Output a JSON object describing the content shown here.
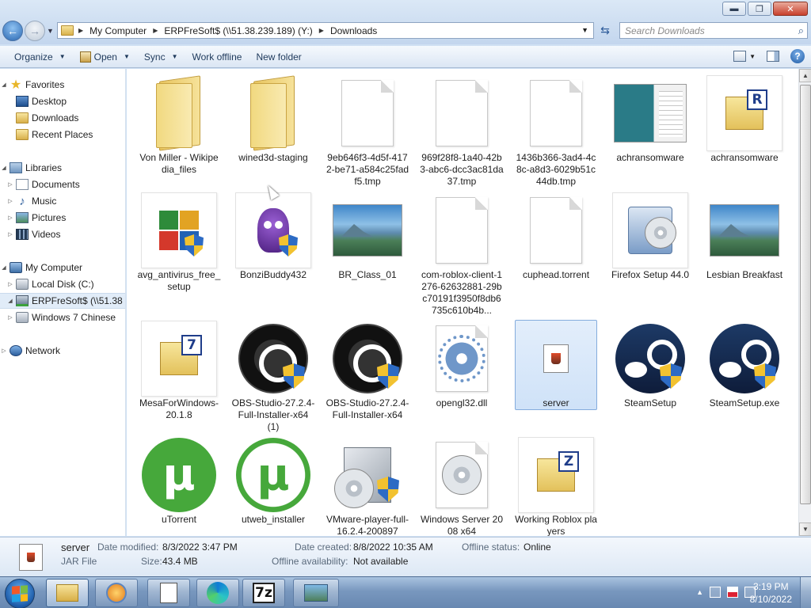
{
  "window": {
    "minimize": "▬",
    "maximize": "❐",
    "close": "✕"
  },
  "address": {
    "crumbs": [
      "My Computer",
      "ERPFreSoft$ (\\\\51.38.239.189) (Y:)",
      "Downloads"
    ],
    "search_placeholder": "Search Downloads"
  },
  "toolbar": {
    "organize": "Organize",
    "open": "Open",
    "sync": "Sync",
    "work_offline": "Work offline",
    "new_folder": "New folder"
  },
  "nav": {
    "favorites": "Favorites",
    "desktop": "Desktop",
    "downloads": "Downloads",
    "recent_places": "Recent Places",
    "libraries": "Libraries",
    "documents": "Documents",
    "music": "Music",
    "pictures": "Pictures",
    "videos": "Videos",
    "my_computer": "My Computer",
    "local_disk": "Local Disk (C:)",
    "erp_drive": "ERPFreSoft$ (\\\\51.38",
    "win7_chinese": "Windows 7 Chinese",
    "network": "Network"
  },
  "files": [
    {
      "name": "Von Miller - Wikipedia_files",
      "icon": "folder-icon"
    },
    {
      "name": "wined3d-staging",
      "icon": "folder-icon"
    },
    {
      "name": "9eb646f3-4d5f-4172-be71-a584c25fadf5.tmp",
      "icon": "blank-file-icon"
    },
    {
      "name": "969f28f8-1a40-42b3-abc6-dcc3ac81da37.tmp",
      "icon": "blank-file-icon"
    },
    {
      "name": "1436b366-3ad4-4c8c-a8d3-6029b51c44db.tmp",
      "icon": "blank-file-icon"
    },
    {
      "name": "achransomware",
      "icon": "screenshot-thumbnail"
    },
    {
      "name": "achransomware",
      "icon": "winrar-archive-icon"
    },
    {
      "name": "avg_antivirus_free_setup",
      "icon": "avg-installer-icon"
    },
    {
      "name": "BonziBuddy432",
      "icon": "bonzibuddy-icon"
    },
    {
      "name": "BR_Class_01",
      "icon": "landscape-image-thumbnail"
    },
    {
      "name": "com-roblox-client-1276-62632881-29bc70191f3950f8db6735c610b4b...",
      "icon": "blank-file-icon"
    },
    {
      "name": "cuphead.torrent",
      "icon": "blank-file-icon"
    },
    {
      "name": "Firefox Setup 44.0",
      "icon": "firefox-setup-icon"
    },
    {
      "name": "Lesbian Breakfast",
      "icon": "landscape-image-thumbnail"
    },
    {
      "name": "MesaForWindows-20.1.8",
      "icon": "7zip-archive-icon"
    },
    {
      "name": "OBS-Studio-27.2.4-Full-Installer-x64 (1)",
      "icon": "obs-icon"
    },
    {
      "name": "OBS-Studio-27.2.4-Full-Installer-x64",
      "icon": "obs-icon"
    },
    {
      "name": "opengl32.dll",
      "icon": "dll-gear-icon"
    },
    {
      "name": "server",
      "icon": "java-jar-icon"
    },
    {
      "name": "SteamSetup",
      "icon": "steam-icon"
    },
    {
      "name": "SteamSetup.exe",
      "icon": "steam-icon"
    },
    {
      "name": "uTorrent",
      "icon": "utorrent-icon"
    },
    {
      "name": "utweb_installer",
      "icon": "utorrent-icon"
    },
    {
      "name": "VMware-player-full-16.2.4-200897",
      "icon": "vmware-installer-icon"
    },
    {
      "name": "Windows Server 2008 x64",
      "icon": "disc-image-icon"
    },
    {
      "name": "Working Roblox players",
      "icon": "7zip-archive-icon"
    }
  ],
  "details": {
    "name": "server",
    "type": "JAR File",
    "date_modified_label": "Date modified:",
    "date_modified": "8/3/2022 3:47 PM",
    "size_label": "Size:",
    "size": "43.4 MB",
    "date_created_label": "Date created:",
    "date_created": "8/8/2022 10:35 AM",
    "offline_avail_label": "Offline availability:",
    "offline_avail": "Not available",
    "offline_status_label": "Offline status:",
    "offline_status": "Online"
  },
  "taskbar": {
    "time": "3:19 PM",
    "date": "8/10/2022",
    "sevenzip": "7z"
  },
  "glyphs": {
    "winrar": "R",
    "sevenzip": "7",
    "zip": "Z",
    "utorrent": "µ"
  }
}
